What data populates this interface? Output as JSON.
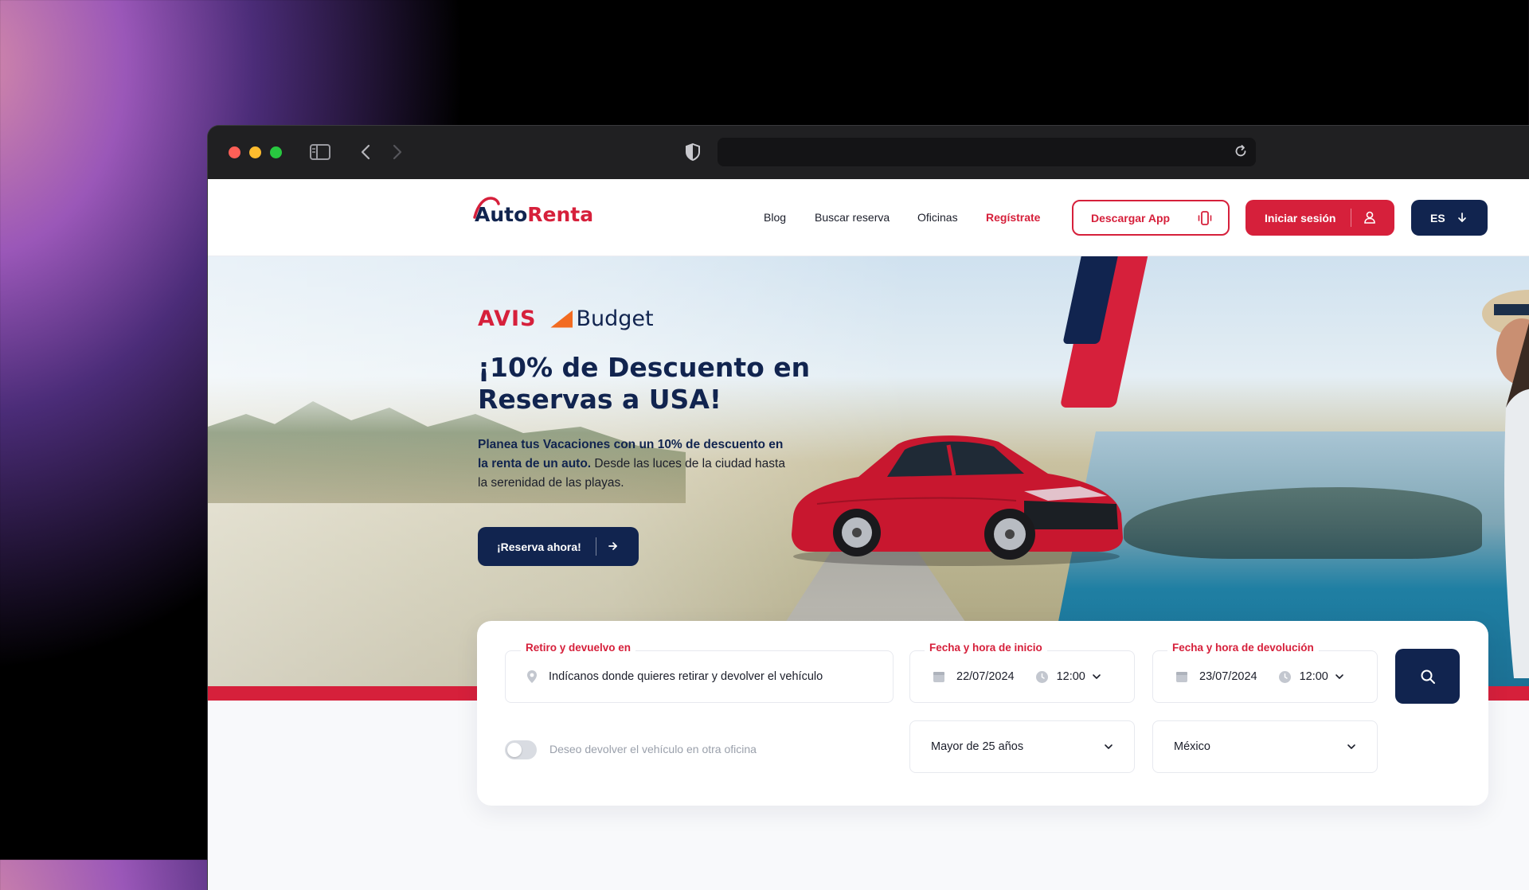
{
  "browser": {
    "url": ""
  },
  "nav": {
    "logo_auto": "Auto",
    "logo_renta": "Renta",
    "links": [
      "Blog",
      "Buscar reserva",
      "Oficinas"
    ],
    "register": "Regístrate",
    "download_app": "Descargar App",
    "login": "Iniciar sesión",
    "language": "ES"
  },
  "hero": {
    "brand_avis": "AVIS",
    "brand_budget": "Budget",
    "title": "¡10% de Descuento en Reservas a USA!",
    "desc_bold": "Planea tus Vacaciones con un 10% de descuento en la renta de un auto.",
    "desc_rest": " Desde las luces de la ciudad hasta la serenidad de las playas.",
    "cta": "¡Reserva ahora!",
    "slide_index": 1
  },
  "booking": {
    "location_label": "Retiro y devuelvo en",
    "location_placeholder": "Indícanos donde quieres retirar y devolver el vehículo",
    "start_label": "Fecha y hora de inicio",
    "start_date": "22/07/2024",
    "start_time": "12:00",
    "return_label": "Fecha y hora de devolución",
    "return_date": "23/07/2024",
    "return_time": "12:00",
    "toggle_text": "Deseo devolver el vehículo en otra oficina",
    "age_option": "Mayor de 25 años",
    "country_option": "México"
  },
  "colors": {
    "brand_red": "#d6203b",
    "brand_navy": "#11244f"
  }
}
